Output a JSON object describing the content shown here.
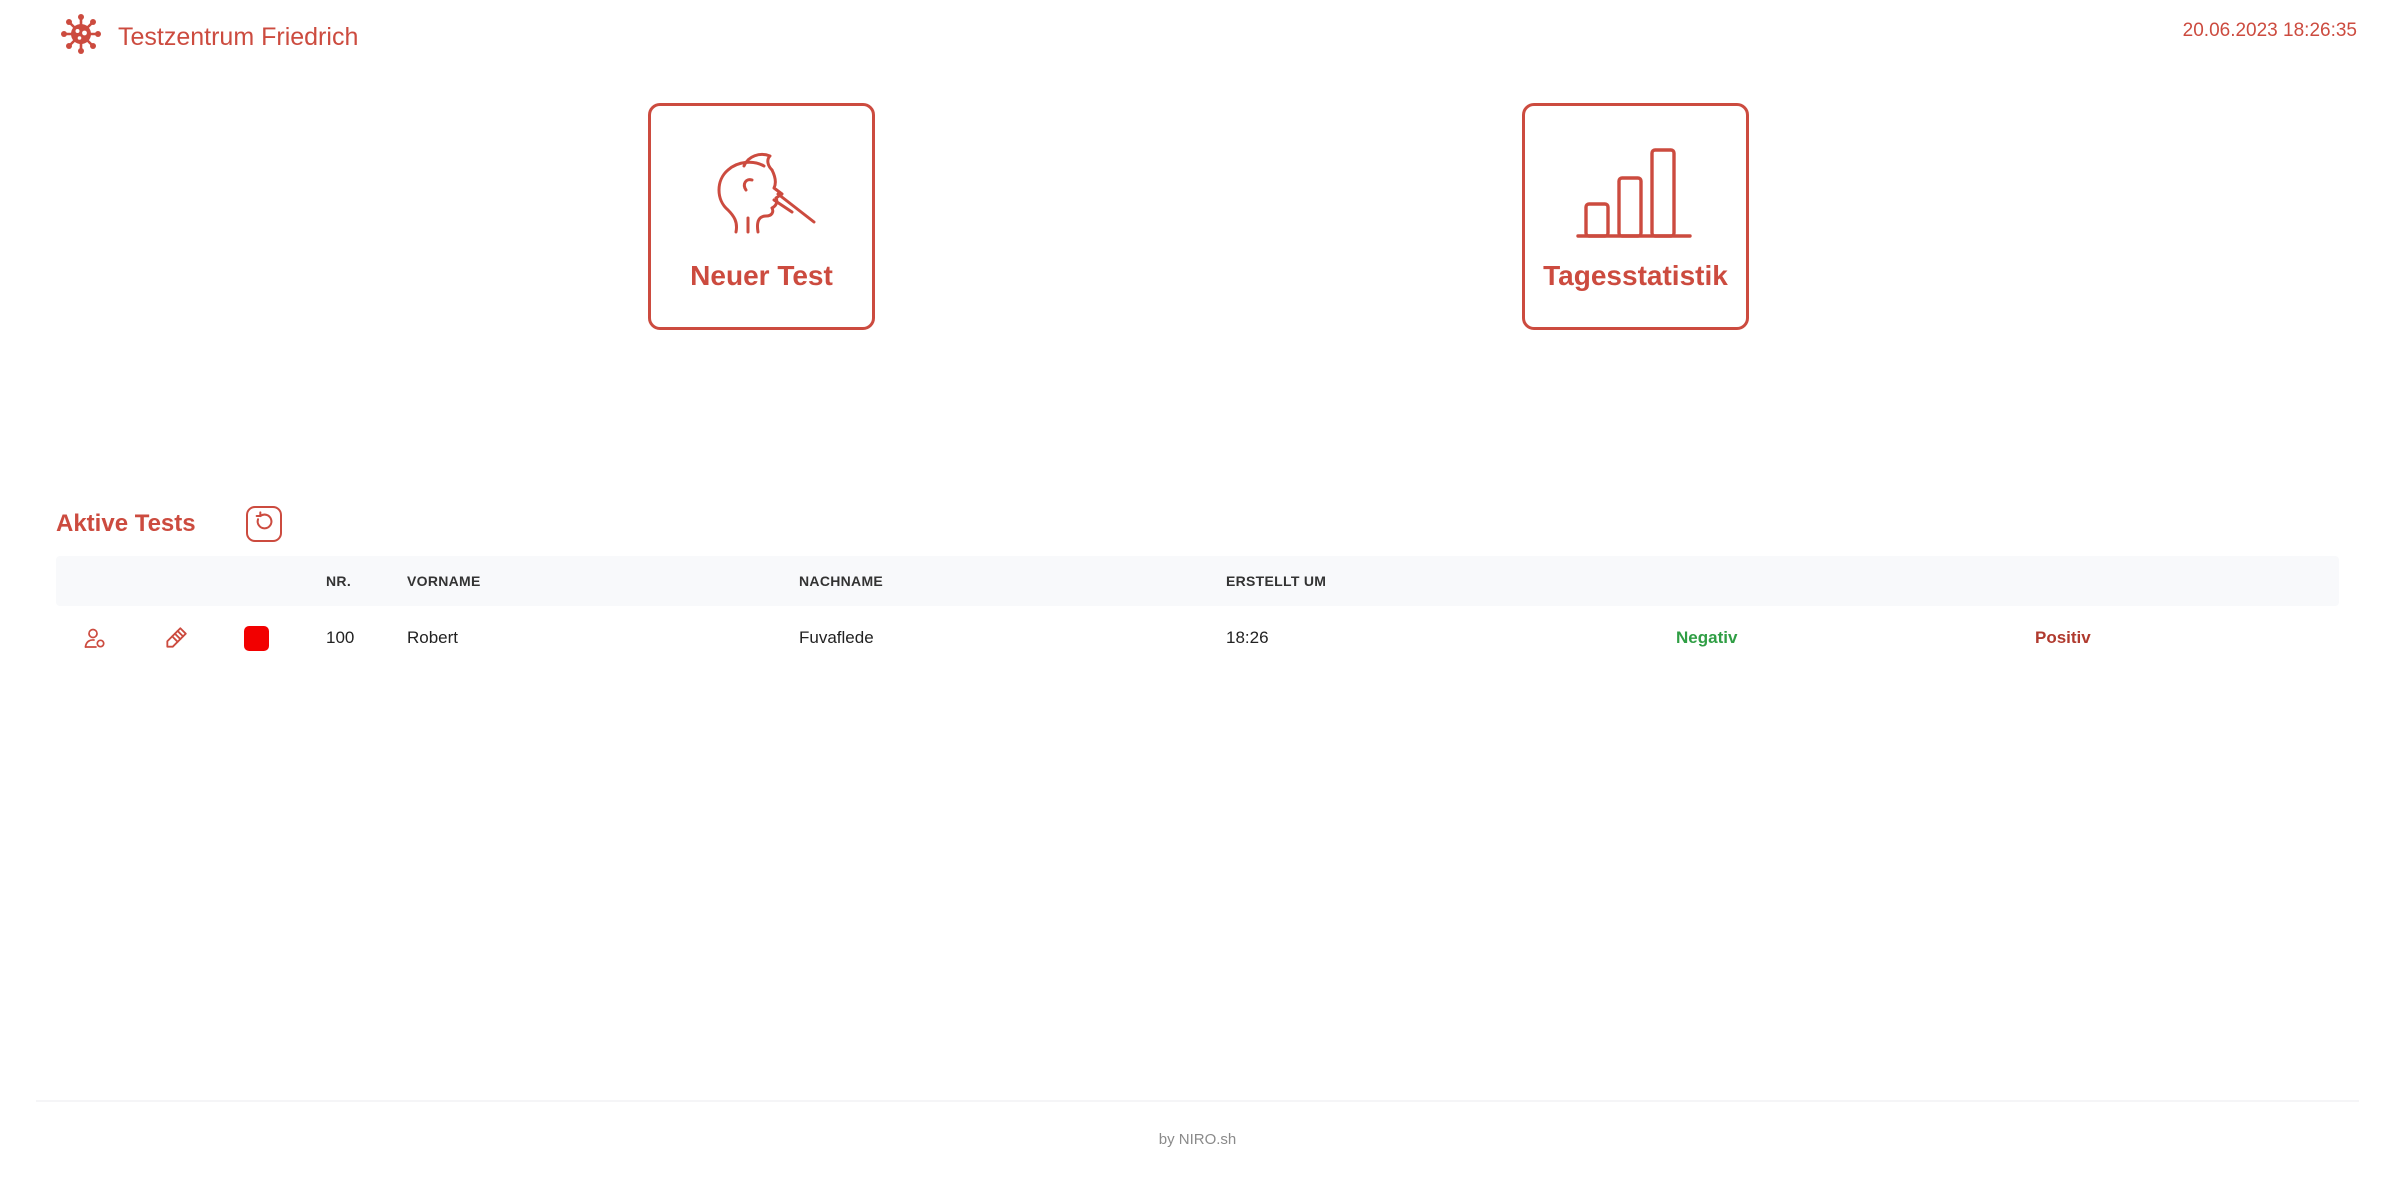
{
  "header": {
    "title": "Testzentrum Friedrich",
    "datetime": "20.06.2023 18:26:35",
    "logo_icon": "virus-icon"
  },
  "tiles": [
    {
      "label": "Neuer Test",
      "icon": "nasal-swab-icon"
    },
    {
      "label": "Tagesstatistik",
      "icon": "bar-chart-icon"
    }
  ],
  "active_tests": {
    "title": "Aktive Tests",
    "refresh_icon": "refresh-icon",
    "columns": {
      "nr": "NR.",
      "vorname": "VORNAME",
      "nachname": "NACHNAME",
      "erstellt": "ERSTELLT UM"
    },
    "rows": [
      {
        "nr": "100",
        "vorname": "Robert",
        "nachname": "Fuvaflede",
        "erstellt": "18:26",
        "status_color": "#f20000",
        "negativ": "Negativ",
        "positiv": "Positiv"
      }
    ]
  },
  "footer": {
    "text": "by NIRO.sh"
  },
  "colors": {
    "accent": "#cc4b3f",
    "negative": "#2f9e44",
    "positive": "#b03a2e",
    "status": "#f20000"
  }
}
